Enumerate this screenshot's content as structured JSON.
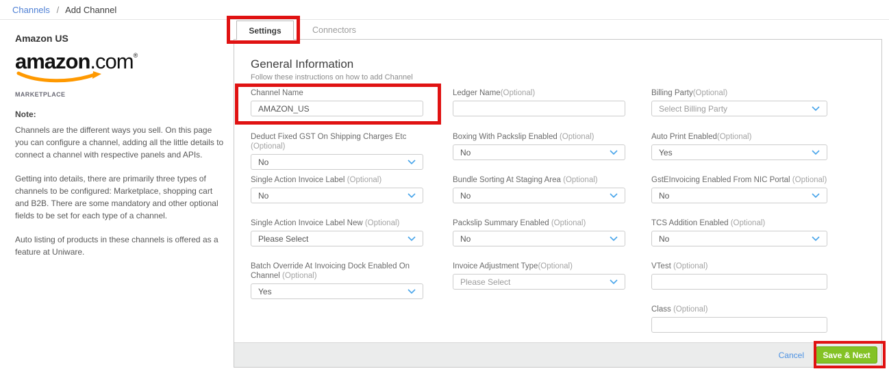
{
  "breadcrumb": {
    "channels": "Channels",
    "separator": "/",
    "current": "Add Channel"
  },
  "sidebar": {
    "channel_title": "Amazon US",
    "logo_brand": "amazon",
    "logo_suffix": ".com",
    "logo_reg": "®",
    "logo_tagline": "MARKETPLACE",
    "note_heading": "Note:",
    "note_paragraphs": [
      "Channels are the different ways you sell. On this page you can configure a channel, adding all the little details to connect a channel with respective panels and APIs.",
      "Getting into details, there are primarily three types of channels to be configured: Marketplace, shopping cart and B2B. There are some mandatory and other optional fields to be set for each type of a channel.",
      "Auto listing of products in these channels is offered as a feature at Uniware."
    ]
  },
  "tabs": {
    "settings": "Settings",
    "connectors": "Connectors"
  },
  "form": {
    "title": "General Information",
    "subtitle": "Follow these instructions on how to add Channel",
    "fields": {
      "channel_name": {
        "label": "Channel Name",
        "optional": "",
        "value": "AMAZON_US"
      },
      "ledger_name": {
        "label": "Ledger Name",
        "optional": "(Optional)",
        "value": ""
      },
      "billing_party": {
        "label": "Billing Party",
        "optional": "(Optional)",
        "value": "Select Billing Party"
      },
      "deduct_fixed_gst": {
        "label": "Deduct Fixed GST On Shipping Charges Etc",
        "optional": " (Optional)",
        "value": "No"
      },
      "boxing_with_packslip": {
        "label": "Boxing With Packslip Enabled",
        "optional": " (Optional)",
        "value": "No"
      },
      "auto_print": {
        "label": "Auto Print Enabled",
        "optional": "(Optional)",
        "value": "Yes"
      },
      "single_action_invoice_label": {
        "label": "Single Action Invoice Label",
        "optional": " (Optional)",
        "value": "No"
      },
      "bundle_sorting": {
        "label": "Bundle Sorting At Staging Area",
        "optional": " (Optional)",
        "value": "No"
      },
      "gst_einvoicing": {
        "label": "GstEInvoicing Enabled From NIC Portal",
        "optional": " (Optional)",
        "value": "No"
      },
      "single_action_invoice_label_new": {
        "label": "Single Action Invoice Label New",
        "optional": " (Optional)",
        "value": "Please Select"
      },
      "packslip_summary": {
        "label": "Packslip Summary Enabled",
        "optional": " (Optional)",
        "value": "No"
      },
      "tcs_addition": {
        "label": "TCS Addition Enabled",
        "optional": " (Optional)",
        "value": "No"
      },
      "batch_override": {
        "label": "Batch Override At Invoicing Dock Enabled On Channel",
        "optional": " (Optional)",
        "value": "Yes"
      },
      "invoice_adjustment_type": {
        "label": "Invoice Adjustment Type",
        "optional": "(Optional)",
        "value": "Please Select"
      },
      "vtest": {
        "label": "VTest",
        "optional": " (Optional)",
        "value": ""
      },
      "class": {
        "label": "Class",
        "optional": " (Optional)",
        "value": ""
      }
    },
    "footer": {
      "cancel": "Cancel",
      "save_next": "Save & Next"
    }
  },
  "colors": {
    "annotation_red": "#e01212",
    "accent_green": "#84c225",
    "link_blue": "#4d7fd4",
    "chevron_blue": "#47a4ea",
    "amazon_orange": "#ff9900"
  }
}
